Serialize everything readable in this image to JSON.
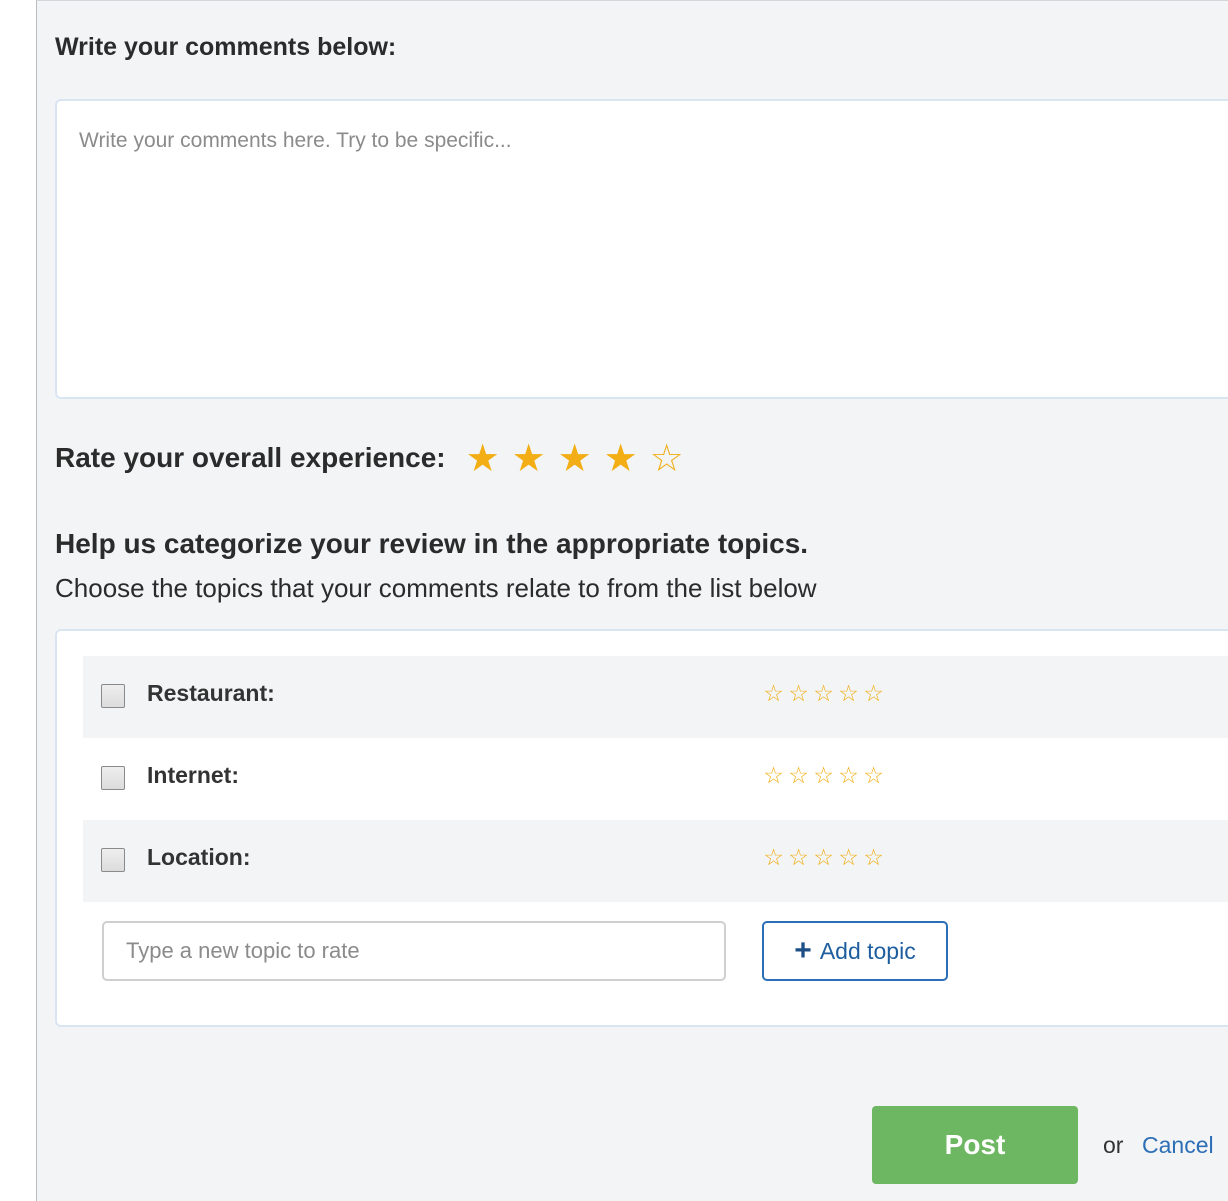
{
  "comments": {
    "heading": "Write your comments below:",
    "placeholder": "Write your comments here. Try to be specific...",
    "value": ""
  },
  "overall_rating": {
    "label": "Rate your overall experience:",
    "value": 4,
    "max": 5,
    "star_color": "#f2ae14"
  },
  "topics": {
    "heading": "Help us categorize your review in the appropriate topics.",
    "subheading": "Choose the topics that your comments relate to from the list below",
    "items": [
      {
        "label": "Restaurant:",
        "checked": false,
        "rating": 0
      },
      {
        "label": "Internet:",
        "checked": false,
        "rating": 0
      },
      {
        "label": "Location:",
        "checked": false,
        "rating": 0
      }
    ],
    "new_topic_placeholder": "Type a new topic to rate",
    "add_topic_label": "Add topic",
    "add_topic_icon": "plus-icon"
  },
  "actions": {
    "post_label": "Post",
    "post_color": "#6db762",
    "or_text": "or",
    "cancel_label": "Cancel",
    "link_color": "#2d6fb5"
  }
}
